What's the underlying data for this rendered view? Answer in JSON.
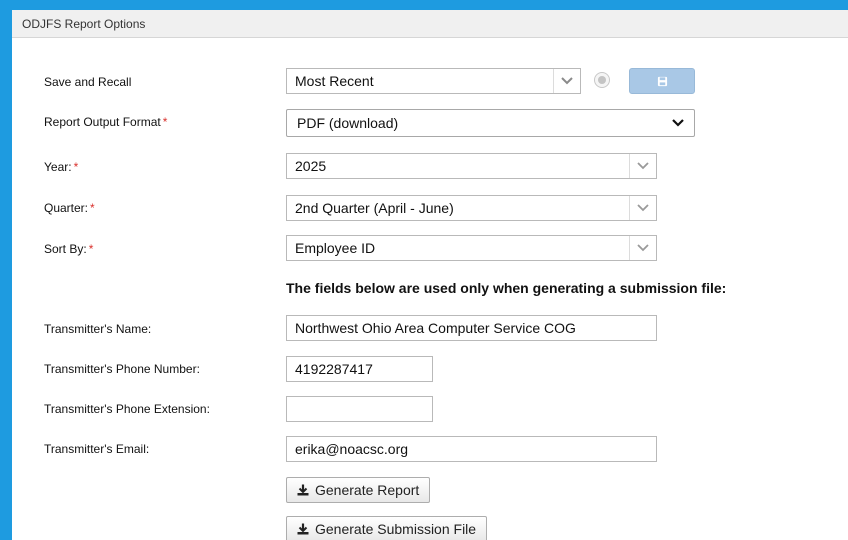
{
  "panel": {
    "title": "ODJFS Report Options"
  },
  "fields": {
    "save_recall": {
      "label": "Save and Recall",
      "value": "Most Recent"
    },
    "output_format": {
      "label": "Report Output Format",
      "required": "*",
      "value": "PDF (download)"
    },
    "year": {
      "label": "Year:",
      "required": "*",
      "value": "2025"
    },
    "quarter": {
      "label": "Quarter:",
      "required": "*",
      "value": "2nd Quarter (April - June)"
    },
    "sort_by": {
      "label": "Sort By:",
      "required": "*",
      "value": "Employee ID"
    }
  },
  "submission_note": "The fields below are used only when generating a submission file:",
  "transmitter": {
    "name": {
      "label": "Transmitter's Name:",
      "value": "Northwest Ohio Area Computer Service COG"
    },
    "phone": {
      "label": "Transmitter's Phone Number:",
      "value": "4192287417"
    },
    "extension": {
      "label": "Transmitter's Phone Extension:",
      "value": ""
    },
    "email": {
      "label": "Transmitter's Email:",
      "value": "erika@noacsc.org"
    }
  },
  "buttons": {
    "generate_report": "Generate Report",
    "generate_submission": "Generate Submission File"
  },
  "icons": {
    "dropdown": "chevron-down-icon",
    "clear": "clear-circle-icon",
    "save": "floppy-disk-icon",
    "download": "download-icon"
  },
  "colors": {
    "background": "#1e9be0",
    "required": "#d9302c",
    "save_button": "#a9c8e6"
  }
}
